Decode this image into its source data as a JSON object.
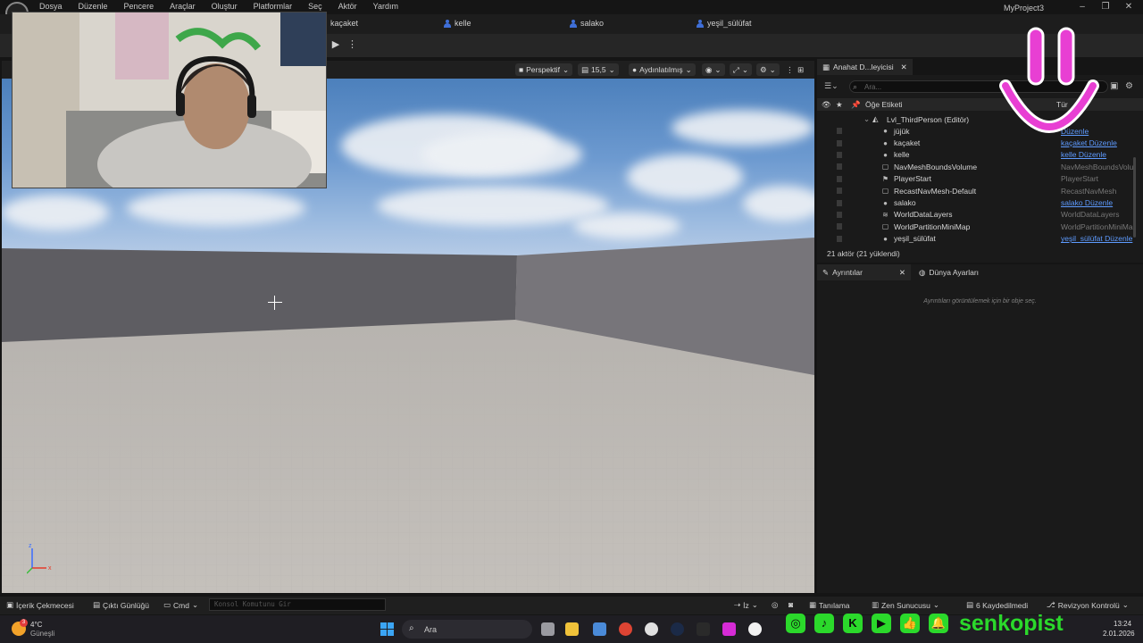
{
  "menu": {
    "items": [
      "Dosya",
      "Düzenle",
      "Pencere",
      "Araçlar",
      "Oluştur",
      "Platformlar",
      "Seç",
      "Aktör",
      "Yardım"
    ],
    "project_name": "MyProject3"
  },
  "players": [
    "kaçaket",
    "kelle",
    "salako",
    "yeşil_sülüfat"
  ],
  "viewport": {
    "perspective_label": "Perspektif",
    "fov_value": "15,5",
    "lighting_label": "Aydınlatılmış",
    "axis": {
      "x": "x",
      "z": "z"
    }
  },
  "outliner": {
    "tab_label": "Anahat D...leyicisi",
    "search_placeholder": "Ara...",
    "col_label": "Öğe Etiketi",
    "col_type": "Tür",
    "level_label": "Lvl_ThirdPerson (Editör)",
    "rows": [
      {
        "label": "jüjük",
        "type": "Düzenle",
        "link": true,
        "icon": "pawn"
      },
      {
        "label": "kaçaket",
        "type": "kaçaket Düzenle",
        "link": true,
        "icon": "pawn"
      },
      {
        "label": "kelle",
        "type": "kelle Düzenle",
        "link": true,
        "icon": "pawn"
      },
      {
        "label": "NavMeshBoundsVolume",
        "type": "NavMeshBoundsVolu",
        "link": false,
        "icon": "box"
      },
      {
        "label": "PlayerStart",
        "type": "PlayerStart",
        "link": false,
        "icon": "flag"
      },
      {
        "label": "RecastNavMesh-Default",
        "type": "RecastNavMesh",
        "link": false,
        "icon": "box"
      },
      {
        "label": "salako",
        "type": "salako Düzenle",
        "link": true,
        "icon": "pawn"
      },
      {
        "label": "WorldDataLayers",
        "type": "WorldDataLayers",
        "link": false,
        "icon": "layers"
      },
      {
        "label": "WorldPartitionMiniMap",
        "type": "WorldPartitionMiniMa",
        "link": false,
        "icon": "box"
      },
      {
        "label": "yeşil_sülüfat",
        "type": "yeşil_sülüfat Düzenle",
        "link": true,
        "icon": "pawn"
      }
    ],
    "actor_count": "21 aktör (21 yüklendi)"
  },
  "details": {
    "tab_label": "Ayrıntılar",
    "world_tab_label": "Dünya Ayarları",
    "empty_message": "Ayrıntıları görüntülemek için bir obje seç."
  },
  "statusbar": {
    "content_drawer": "İçerik Çekmecesi",
    "output_log": "Çıktı Günlüğü",
    "cmd": "Cmd",
    "console_placeholder": "Konsol Komutunu Gir",
    "iz": "İz",
    "diagnostics": "Tanılama",
    "zen": "Zen Sunucusu",
    "saved": "6 Kaydedilmedi",
    "revision": "Revizyon Kontrolü"
  },
  "taskbar": {
    "weather_temp": "4°C",
    "weather_desc": "Güneşli",
    "weather_badge": "3",
    "search_label": "Ara",
    "time": "13:24",
    "date": "2.01.2026"
  },
  "overlay": {
    "brand": "senkopist",
    "brand_color": "#2bd92b",
    "smiley_color": "#e83fd3",
    "social_icons": [
      "instagram-icon",
      "tiktok-icon",
      "kick-icon",
      "youtube-icon",
      "thumbs-up-icon",
      "bell-icon"
    ]
  }
}
